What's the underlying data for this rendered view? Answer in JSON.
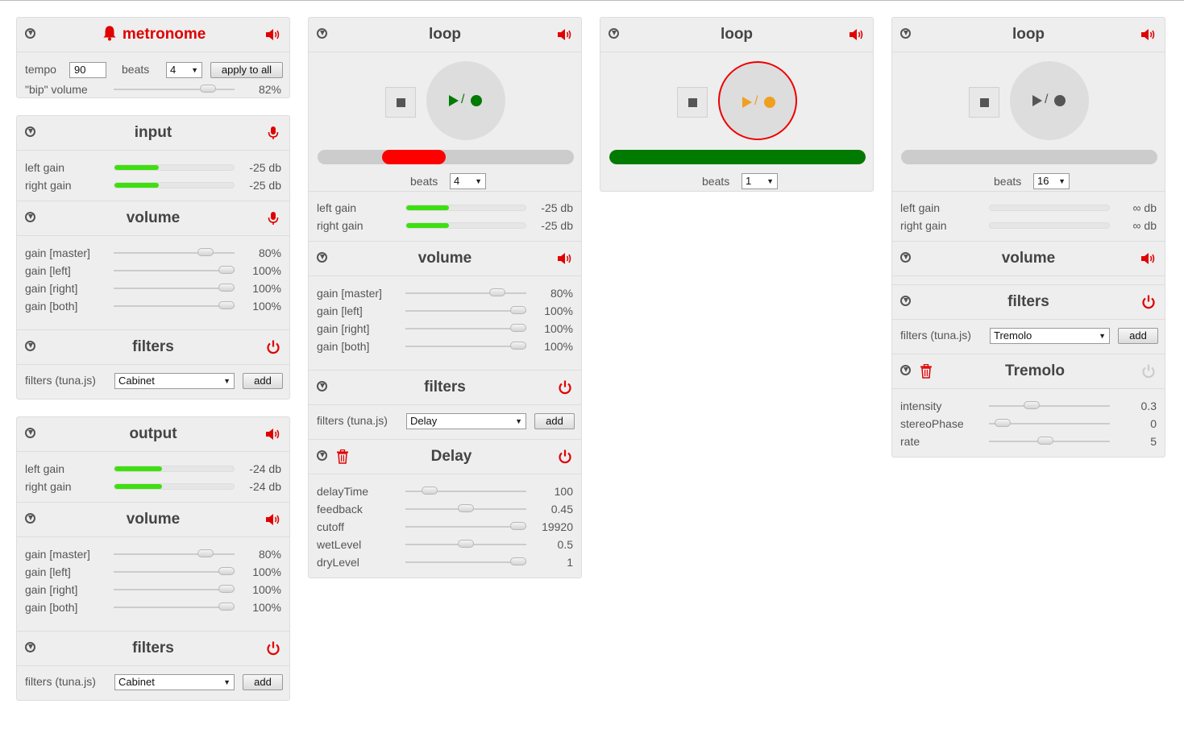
{
  "metronome": {
    "title": "metronome",
    "tempo_label": "tempo",
    "tempo_value": "90",
    "beats_label": "beats",
    "beats_value": "4",
    "apply_label": "apply to all",
    "bip_label": "\"bip\" volume",
    "bip_value": "82%",
    "bip_level": 0.82
  },
  "col1": {
    "input": {
      "title": "input",
      "left_label": "left gain",
      "left_value": "-25 db",
      "left_level": 0.37,
      "right_label": "right gain",
      "right_value": "-25 db",
      "right_level": 0.37
    },
    "input_volume": {
      "title": "volume",
      "rows": [
        {
          "label": "gain [master]",
          "value": "80%",
          "level": 0.8
        },
        {
          "label": "gain [left]",
          "value": "100%",
          "level": 1.0
        },
        {
          "label": "gain [right]",
          "value": "100%",
          "level": 1.0
        },
        {
          "label": "gain [both]",
          "value": "100%",
          "level": 1.0
        }
      ]
    },
    "input_filters": {
      "title": "filters",
      "label": "filters (tuna.js)",
      "selected": "Cabinet",
      "add_label": "add"
    },
    "output": {
      "title": "output",
      "left_label": "left gain",
      "left_value": "-24 db",
      "left_level": 0.4,
      "right_label": "right gain",
      "right_value": "-24 db",
      "right_level": 0.4
    },
    "output_volume": {
      "title": "volume",
      "rows": [
        {
          "label": "gain [master]",
          "value": "80%",
          "level": 0.8
        },
        {
          "label": "gain [left]",
          "value": "100%",
          "level": 1.0
        },
        {
          "label": "gain [right]",
          "value": "100%",
          "level": 1.0
        },
        {
          "label": "gain [both]",
          "value": "100%",
          "level": 1.0
        }
      ]
    },
    "output_filters": {
      "title": "filters",
      "label": "filters (tuna.js)",
      "selected": "Cabinet",
      "add_label": "add"
    }
  },
  "loop1": {
    "title": "loop",
    "play_color": "#007a00",
    "progress_color": "#ff0000",
    "progress_start": 0.25,
    "progress_fraction": 0.25,
    "beats_label": "beats",
    "beats_value": "4",
    "left_label": "left gain",
    "left_value": "-25 db",
    "left_level": 0.36,
    "right_label": "right gain",
    "right_value": "-25 db",
    "right_level": 0.36,
    "volume": {
      "title": "volume",
      "rows": [
        {
          "label": "gain [master]",
          "value": "80%",
          "level": 0.8
        },
        {
          "label": "gain [left]",
          "value": "100%",
          "level": 1.0
        },
        {
          "label": "gain [right]",
          "value": "100%",
          "level": 1.0
        },
        {
          "label": "gain [both]",
          "value": "100%",
          "level": 1.0
        }
      ]
    },
    "filters": {
      "title": "filters",
      "label": "filters (tuna.js)",
      "selected": "Delay",
      "add_label": "add"
    },
    "delay": {
      "title": "Delay",
      "rows": [
        {
          "label": "delayTime",
          "value": "100",
          "level": 0.15
        },
        {
          "label": "feedback",
          "value": "0.45",
          "level": 0.5
        },
        {
          "label": "cutoff",
          "value": "19920",
          "level": 1.0
        },
        {
          "label": "wetLevel",
          "value": "0.5",
          "level": 0.5
        },
        {
          "label": "dryLevel",
          "value": "1",
          "level": 1.0
        }
      ]
    }
  },
  "loop2": {
    "title": "loop",
    "play_color": "#f0a020",
    "progress_color": "#007a00",
    "progress_start": 0,
    "progress_fraction": 1.0,
    "beats_label": "beats",
    "beats_value": "1"
  },
  "loop3": {
    "title": "loop",
    "play_color": "#555555",
    "progress_color": "#cccccc",
    "progress_start": 0,
    "progress_fraction": 0,
    "beats_label": "beats",
    "beats_value": "16",
    "left_label": "left gain",
    "left_value": "∞ db",
    "left_level": 0,
    "right_label": "right gain",
    "right_value": "∞ db",
    "right_level": 0,
    "volume": {
      "title": "volume"
    },
    "filters": {
      "title": "filters",
      "label": "filters (tuna.js)",
      "selected": "Tremolo",
      "add_label": "add"
    },
    "tremolo": {
      "title": "Tremolo",
      "rows": [
        {
          "label": "intensity",
          "value": "0.3",
          "level": 0.33
        },
        {
          "label": "stereoPhase",
          "value": "0",
          "level": 0.05
        },
        {
          "label": "rate",
          "value": "5",
          "level": 0.46
        }
      ]
    }
  },
  "colors": {
    "accent_red": "#e00000",
    "meter_green": "#3edf10",
    "panel_bg": "#eeeeee"
  },
  "icons": {
    "download": "download-circle-icon",
    "speaker": "speaker-icon",
    "mic": "microphone-icon",
    "power": "power-icon",
    "bell": "bell-icon",
    "trash": "trash-icon"
  }
}
